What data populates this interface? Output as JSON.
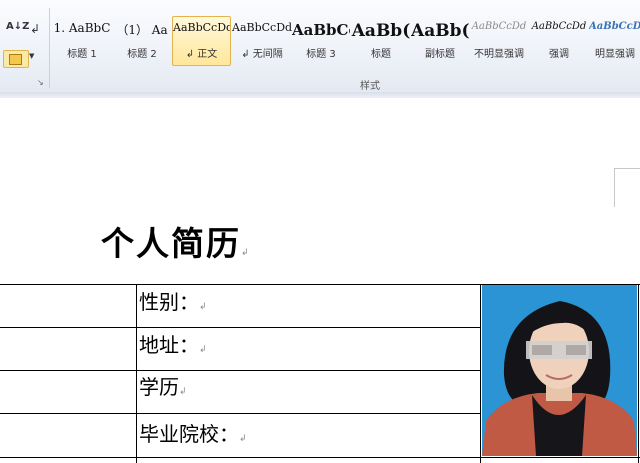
{
  "ribbon": {
    "group_label": "样式",
    "sort_glyph": "A↓Z",
    "paragraph_glyph": "↲",
    "launcher_glyph": "↘"
  },
  "styles": [
    {
      "preview": "1. AaBbC",
      "name": "标题 1"
    },
    {
      "preview": "（1） Aa",
      "name": "标题 2"
    },
    {
      "preview": "AaBbCcDd",
      "name": "↲ 正文",
      "selected": true
    },
    {
      "preview": "AaBbCcDd",
      "name": "↲ 无间隔"
    },
    {
      "preview": "AaBbCc",
      "name": "标题 3"
    },
    {
      "preview": "AaBb(",
      "name": "标题"
    },
    {
      "preview": "AaBb(",
      "name": "副标题"
    },
    {
      "preview": "AaBbCcDd",
      "name": "不明显强调"
    },
    {
      "preview": "AaBbCcDd",
      "name": "强调"
    },
    {
      "preview": "AaBbCcDd",
      "name": "明显强调"
    }
  ],
  "document": {
    "title": "个人简历",
    "pilcrow": "↲",
    "rows": [
      {
        "label": "性别：",
        "mark": "↲"
      },
      {
        "label": "地址：",
        "mark": "↲"
      },
      {
        "label": "学历",
        "mark": "↲"
      },
      {
        "label": "毕业院校：",
        "mark": "↲"
      }
    ]
  },
  "colors": {
    "photo_background": "#2b94d4",
    "selected_style_border": "#e3b44d"
  }
}
